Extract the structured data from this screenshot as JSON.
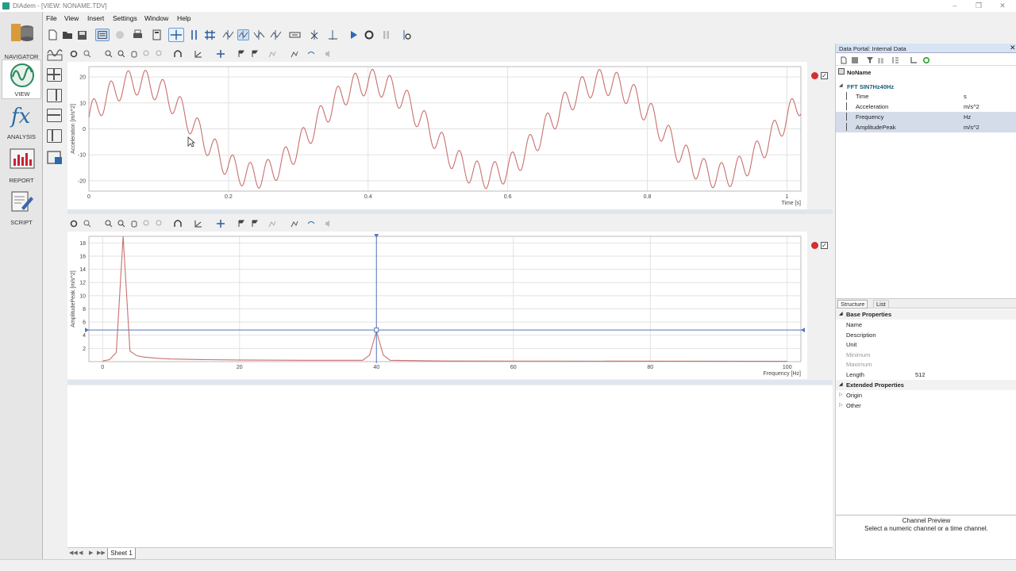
{
  "window": {
    "title": "DIAdem - [VIEW:  NONAME.TDV]"
  },
  "menu": [
    "File",
    "View",
    "Insert",
    "Settings",
    "Window",
    "Help"
  ],
  "nav": [
    {
      "label": "NAVIGATOR",
      "icon": "navigator-icon"
    },
    {
      "label": "VIEW",
      "icon": "view-icon"
    },
    {
      "label": "ANALYSIS",
      "icon": "analysis-fx-icon"
    },
    {
      "label": "REPORT",
      "icon": "report-icon"
    },
    {
      "label": "SCRIPT",
      "icon": "script-icon"
    }
  ],
  "colors": {
    "curve": "#c8706e",
    "cursor": "#5878b8",
    "accent": "#2a8a7a",
    "selection": "#d4dcea"
  },
  "chart_data": [
    {
      "type": "line",
      "ylabel": "Acceleration [m/s^2]",
      "xlabel": "Time [s]",
      "xlim": [
        0,
        1.02
      ],
      "ylim": [
        -24,
        24
      ],
      "xticks": [
        "0",
        "0.2",
        "0.4",
        "0.6",
        "0.8",
        "1"
      ],
      "yticks": [
        "20",
        "10",
        "0",
        "-10",
        "-20"
      ],
      "signal": {
        "components": [
          {
            "freq_hz": 3,
            "amp": 18
          },
          {
            "freq_hz": 40,
            "amp": 5
          }
        ]
      }
    },
    {
      "type": "line",
      "ylabel": "AmplitudePeak [m/s^2]",
      "xlabel": "Frequency [Hz]",
      "xlim": [
        -2,
        102
      ],
      "ylim": [
        0,
        19
      ],
      "xticks": [
        "0",
        "20",
        "40",
        "60",
        "80",
        "100"
      ],
      "yticks": [
        "18",
        "16",
        "14",
        "12",
        "10",
        "8",
        "6",
        "4",
        "2"
      ],
      "x": [
        0,
        1,
        2,
        3,
        4,
        5,
        6,
        8,
        10,
        15,
        20,
        30,
        38,
        39,
        40,
        41,
        42,
        50,
        100
      ],
      "y": [
        0.1,
        0.3,
        1.4,
        19.0,
        1.6,
        0.9,
        0.7,
        0.5,
        0.4,
        0.3,
        0.25,
        0.2,
        0.2,
        1.0,
        4.6,
        1.0,
        0.2,
        0.1,
        0.05
      ],
      "cursor": {
        "x": 40,
        "y": 4.8
      }
    }
  ],
  "portal": {
    "title": "Data Portal: Internal Data",
    "root": "NoName",
    "group": "FFT SIN7Hz40Hz",
    "channels": [
      {
        "name": "Time",
        "unit": "s",
        "selected": false
      },
      {
        "name": "Acceleration",
        "unit": "m/s^2",
        "selected": false
      },
      {
        "name": "Frequency",
        "unit": "Hz",
        "selected": true
      },
      {
        "name": "AmplitudePeak",
        "unit": "m/s^2",
        "selected": true
      }
    ],
    "tabs": [
      "Structure",
      "List"
    ],
    "base_properties_title": "Base Properties",
    "properties": [
      {
        "name": "Name",
        "value": "",
        "dim": false
      },
      {
        "name": "Description",
        "value": "",
        "dim": false
      },
      {
        "name": "Unit",
        "value": "",
        "dim": false
      },
      {
        "name": "Minimum",
        "value": "",
        "dim": true
      },
      {
        "name": "Maximum",
        "value": "",
        "dim": true
      },
      {
        "name": "Length",
        "value": "512",
        "dim": false
      }
    ],
    "extended_title": "Extended Properties",
    "extended": [
      "Origin",
      "Other"
    ],
    "preview_title": "Channel Preview",
    "preview_text": "Select a numeric channel or a time channel."
  },
  "sheet_tab": "Sheet 1"
}
